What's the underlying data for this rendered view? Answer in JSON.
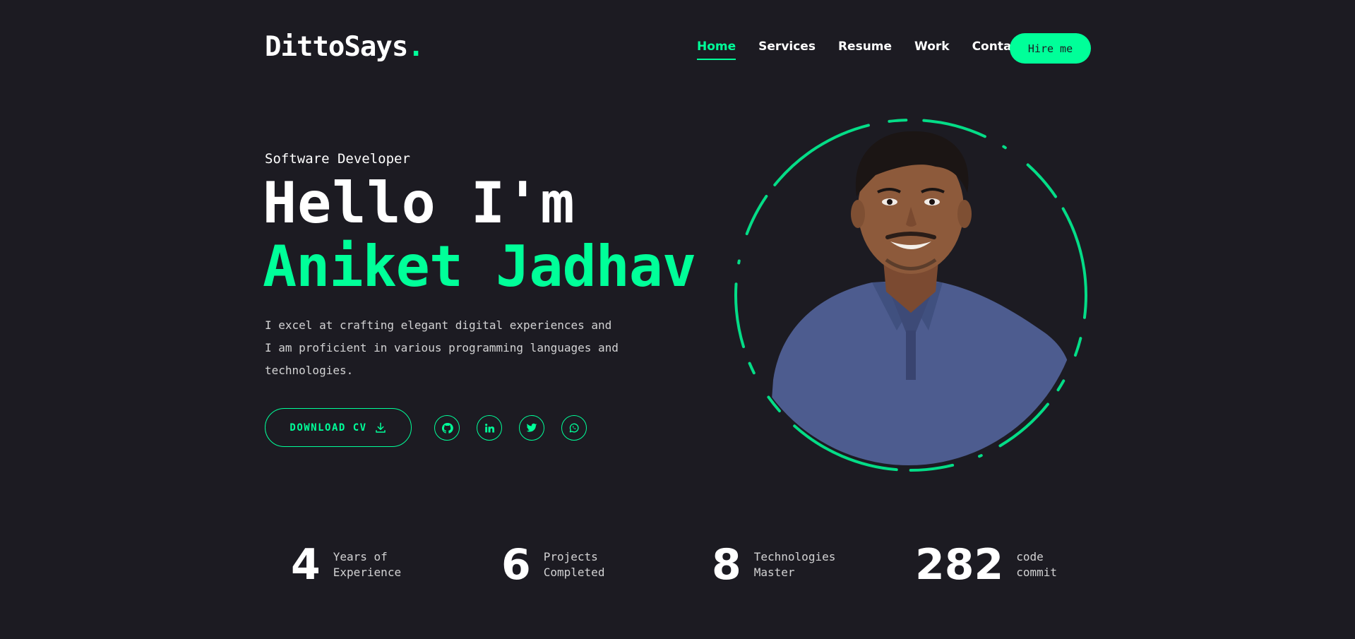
{
  "logo": {
    "text": "DittoSays",
    "dot": "."
  },
  "nav": {
    "items": [
      "Home",
      "Services",
      "Resume",
      "Work",
      "Contact"
    ],
    "active": "Home",
    "hire_label": "Hire me"
  },
  "hero": {
    "role": "Software Developer",
    "greeting": "Hello I'm",
    "name": "Aniket Jadhav",
    "description_lines": [
      "I excel at crafting elegant digital experiences and",
      "I am proficient in various programming languages and",
      "technologies."
    ],
    "cv_label": "DOWNLOAD CV",
    "socials": [
      "github-icon",
      "linkedin-icon",
      "twitter-icon",
      "whatsapp-icon"
    ]
  },
  "stats": [
    {
      "value": "4",
      "label_line1": "Years of",
      "label_line2": "Experience"
    },
    {
      "value": "6",
      "label_line1": "Projects",
      "label_line2": "Completed"
    },
    {
      "value": "8",
      "label_line1": "Technologies",
      "label_line2": "Master"
    },
    {
      "value": "282",
      "label_line1": "code",
      "label_line2": "commit"
    }
  ],
  "colors": {
    "accent": "#00ff99",
    "background": "#1c1b22",
    "shirt": "#4a5a8e"
  }
}
